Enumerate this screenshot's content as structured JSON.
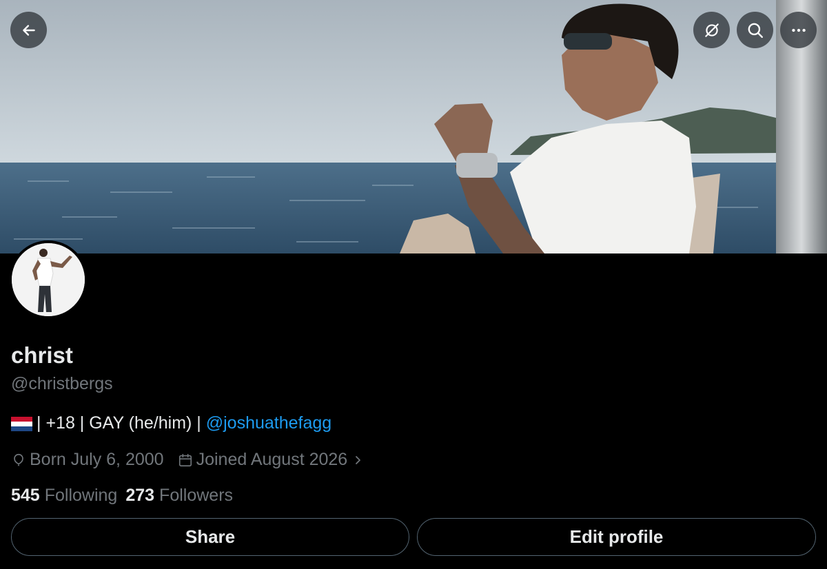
{
  "header": {
    "back_icon": "arrow-left-icon",
    "actions": [
      "cancel-sync-icon",
      "search-icon",
      "more-icon"
    ]
  },
  "profile": {
    "display_name": "christ",
    "handle": "@christbergs",
    "bio": {
      "flag": "netherlands-flag",
      "text": "| +18 | GAY (he/him) |",
      "mention": "@joshuathefagg"
    },
    "born": "Born July 6, 2000",
    "joined": "Joined August 2026"
  },
  "stats": {
    "following_count": "545",
    "following_label": "Following",
    "followers_count": "273",
    "followers_label": "Followers"
  },
  "buttons": {
    "share": "Share",
    "edit_profile": "Edit profile"
  },
  "colors": {
    "background": "#000000",
    "text": "#e7e9ea",
    "muted": "#71767b",
    "link": "#1d9bf0",
    "border": "#536471"
  }
}
